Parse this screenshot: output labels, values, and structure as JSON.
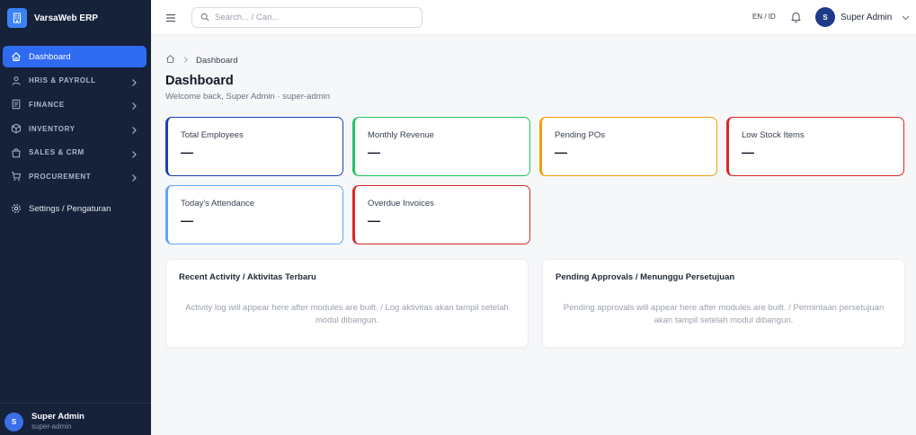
{
  "app": {
    "name": "VarsaWeb ERP"
  },
  "sidebar": {
    "items": [
      {
        "label": "Dashboard",
        "icon": "home-icon"
      },
      {
        "label": "HRIS & PAYROLL",
        "icon": "users-icon"
      },
      {
        "label": "FINANCE",
        "icon": "ledger-icon"
      },
      {
        "label": "INVENTORY",
        "icon": "box-icon"
      },
      {
        "label": "SALES & CRM",
        "icon": "bag-icon"
      },
      {
        "label": "PROCUREMENT",
        "icon": "cart-icon"
      },
      {
        "label": "Settings / Pengaturan",
        "icon": "gear-icon"
      }
    ],
    "user": {
      "initial": "S",
      "name": "Super Admin",
      "role": "super-admin"
    }
  },
  "topbar": {
    "search_placeholder": "Search... / Cari...",
    "lang": "EN / ID",
    "user": {
      "initial": "S",
      "name": "Super Admin"
    }
  },
  "breadcrumb": {
    "current": "Dashboard"
  },
  "page": {
    "title": "Dashboard",
    "subtitle": "Welcome back, Super Admin · super-admin"
  },
  "stats": [
    {
      "label": "Total Employees",
      "value": "—",
      "color": "#1e40af"
    },
    {
      "label": "Monthly Revenue",
      "value": "—",
      "color": "#22c55e"
    },
    {
      "label": "Pending POs",
      "value": "—",
      "color": "#f59e0b"
    },
    {
      "label": "Low Stock Items",
      "value": "—",
      "color": "#dc2626"
    },
    {
      "label": "Today's Attendance",
      "value": "—",
      "color": "#60a5fa"
    },
    {
      "label": "Overdue Invoices",
      "value": "—",
      "color": "#dc2626"
    }
  ],
  "panels": {
    "activity": {
      "title": "Recent Activity / Aktivitas Terbaru",
      "body": "Activity log will appear here after modules are built. / Log aktivitas akan tampil setelah modul dibangun."
    },
    "approvals": {
      "title": "Pending Approvals / Menunggu Persetujuan",
      "body": "Pending approvals will appear here after modules are built. / Permintaan persetujuan akan tampil setelah modul dibangun."
    }
  },
  "colors": {
    "sidebar_bg": "#16223a",
    "accent": "#2f6bf2"
  }
}
